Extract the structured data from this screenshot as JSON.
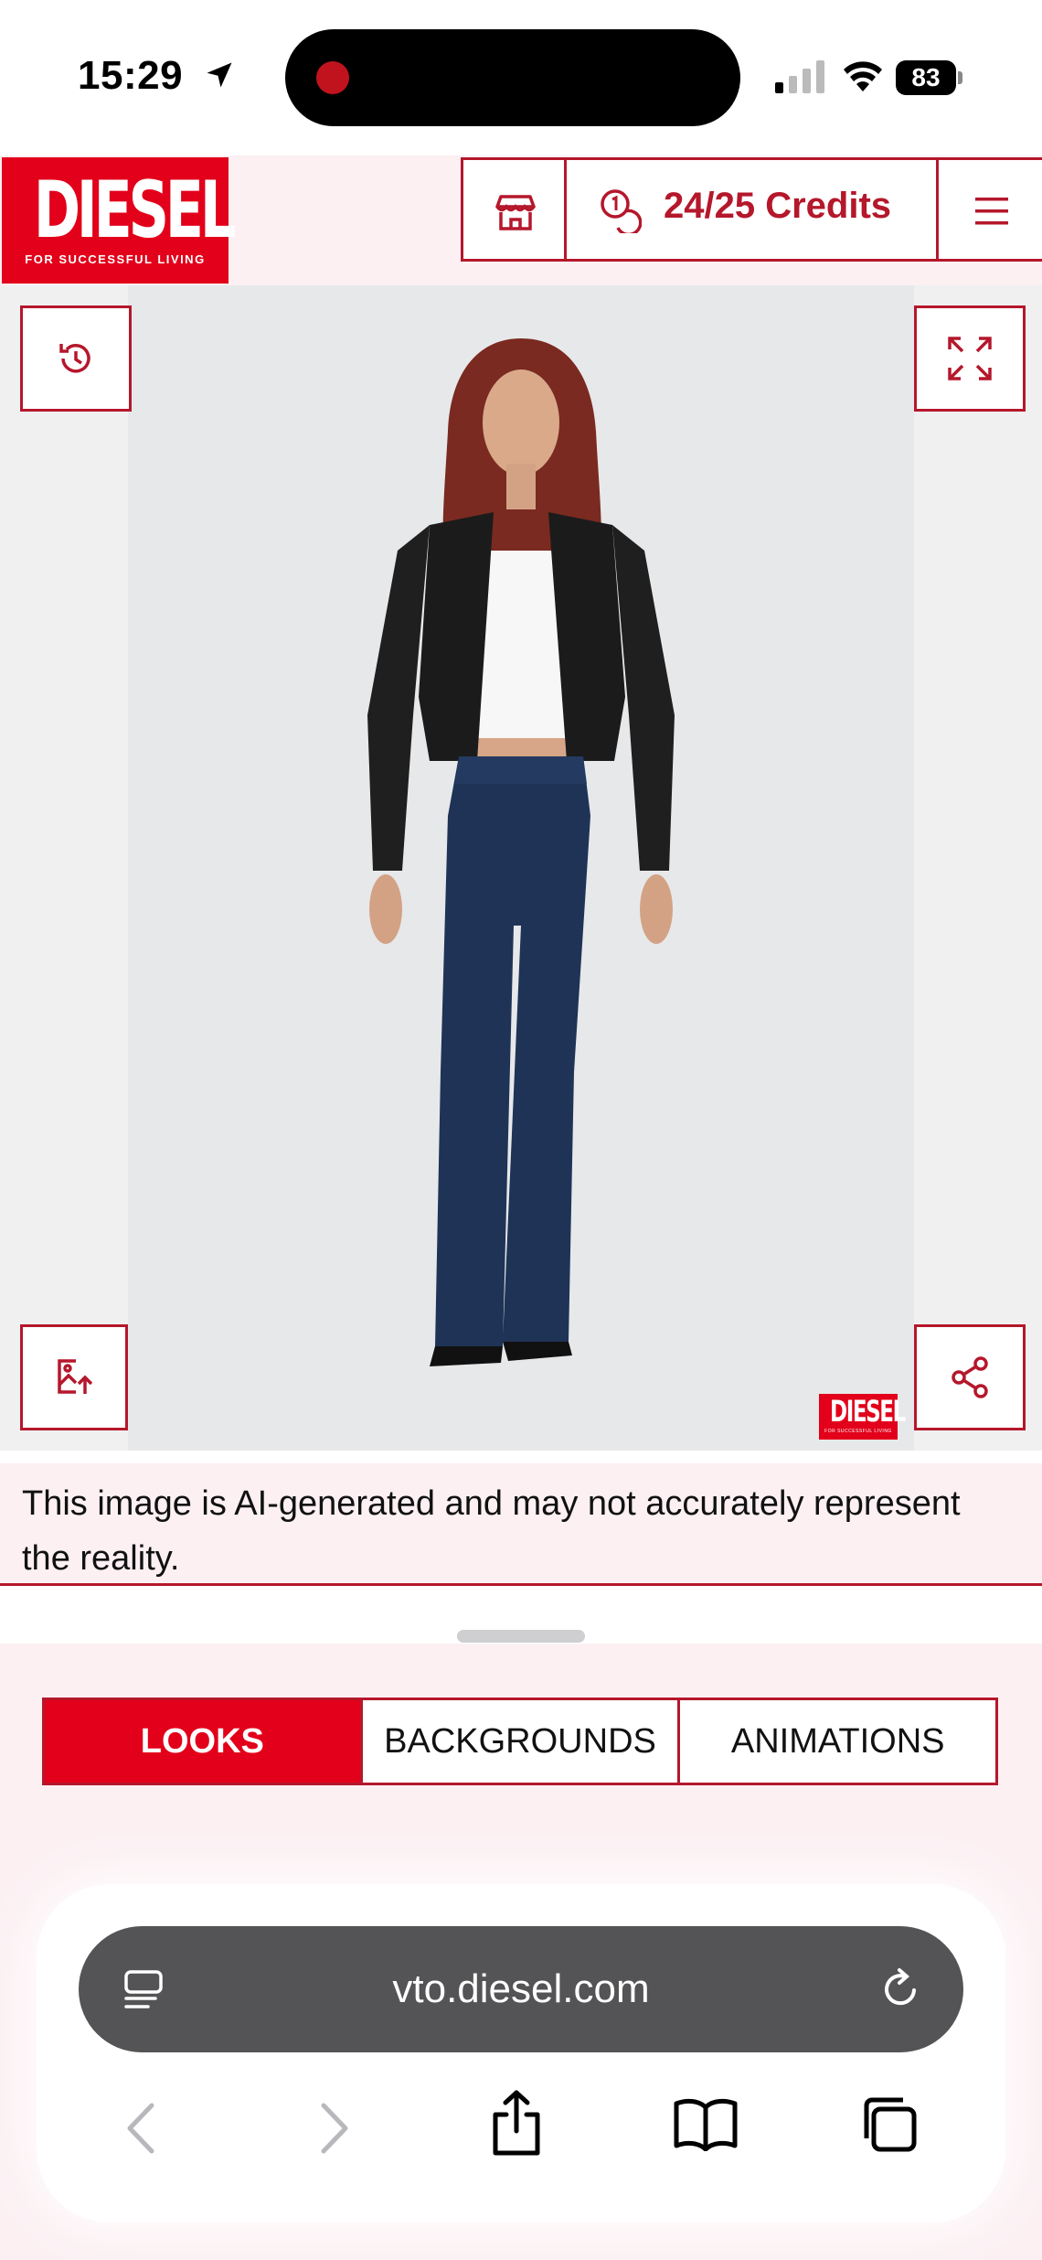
{
  "status_bar": {
    "time": "15:29",
    "battery": "83",
    "icons": [
      "location-arrow-icon",
      "recording-dot-icon",
      "cellular-signal-icon",
      "wifi-icon",
      "battery-icon"
    ]
  },
  "header": {
    "logo_word": "DIESEL",
    "logo_tagline": "FOR SUCCESSFUL LIVING",
    "credits": "24/25 Credits",
    "icons": [
      "store-icon",
      "coins-icon",
      "hamburger-menu-icon"
    ],
    "brand_color": "#e2001a",
    "border_color": "#b5172b"
  },
  "image_panel": {
    "watermark_word": "DIESEL",
    "watermark_tagline": "FOR SUCCESSFUL LIVING",
    "icons": [
      "history-icon",
      "expand-icon",
      "image-upload-icon",
      "share-icon"
    ]
  },
  "disclaimer": "This image is AI-generated and may not accurately represent the reality.",
  "tabs": {
    "items": [
      {
        "label": "LOOKS",
        "active": true
      },
      {
        "label": "BACKGROUNDS",
        "active": false
      },
      {
        "label": "ANIMATIONS",
        "active": false
      }
    ]
  },
  "browser": {
    "url": "vto.diesel.com",
    "icons": [
      "reader-icon",
      "reload-icon",
      "back-icon",
      "forward-icon",
      "share-icon",
      "bookmarks-icon",
      "tabs-icon"
    ]
  }
}
